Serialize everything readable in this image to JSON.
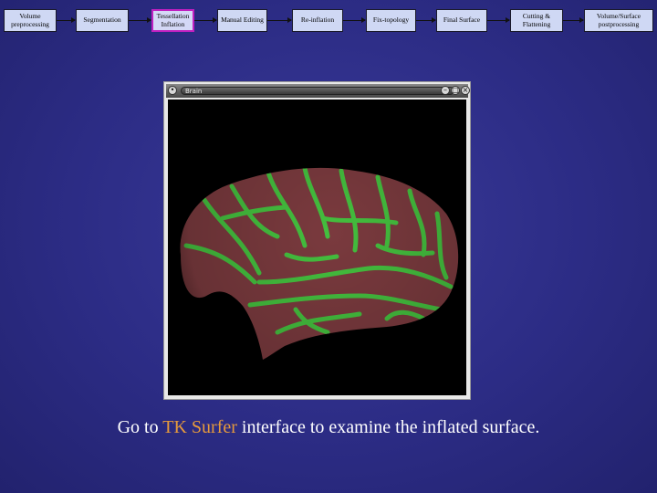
{
  "pipeline": {
    "steps": [
      {
        "label": "Volume preprocessing"
      },
      {
        "label": "Segmentation"
      },
      {
        "label": "Tessellation Inflation"
      },
      {
        "label": "Manual Editing"
      },
      {
        "label": "Re-inflation"
      },
      {
        "label": "Fix-topology"
      },
      {
        "label": "Final Surface"
      },
      {
        "label": "Cutting & Flattening"
      },
      {
        "label": "Volume/Surface postprocessing"
      }
    ],
    "active_step": "Tessellation Inflation",
    "active_border_color": "#c020c0"
  },
  "window": {
    "title": "Brain",
    "buttons": [
      "minimize",
      "maximize",
      "close"
    ],
    "icons": [
      "menu-icon",
      "minimize-icon",
      "maximize-icon",
      "close-icon"
    ]
  },
  "caption": {
    "prefix": "Go to ",
    "highlight": "TK Surfer",
    "suffix": " interface to examine the inflated surface.",
    "highlight_color": "#e69a3c"
  },
  "surface_colors": {
    "gyri": "#7a3a3e",
    "sulci": "#3fcf3f"
  }
}
